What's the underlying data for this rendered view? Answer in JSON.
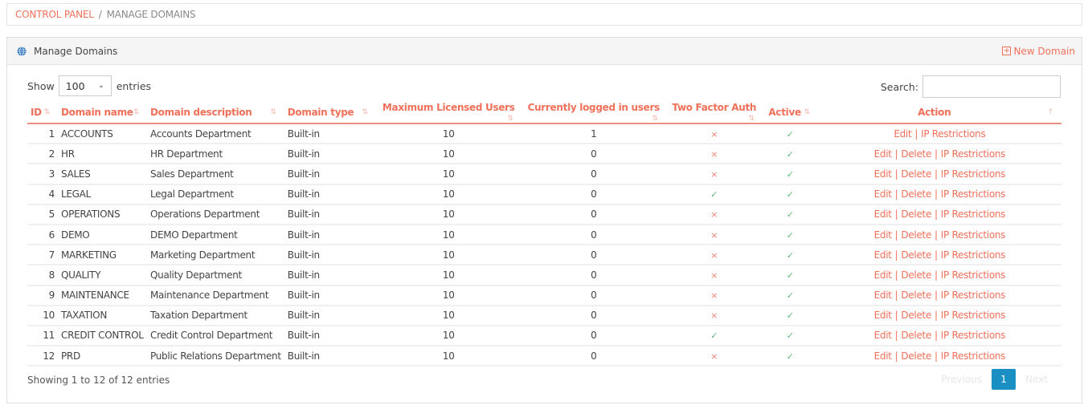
{
  "breadcrumb": {
    "home": "CONTROL PANEL",
    "separator": "/",
    "current": "MANAGE DOMAINS"
  },
  "panel": {
    "title": "Manage Domains",
    "icon": "globe-icon",
    "new_button": "New Domain"
  },
  "controls": {
    "show_label": "Show",
    "page_length": "100",
    "entries_label": "entries",
    "search_label": "Search:",
    "search_value": ""
  },
  "table": {
    "headers": [
      "ID",
      "Domain name",
      "Domain description",
      "Domain type",
      "Maximum Licensed Users",
      "Currently logged in users",
      "Two Factor Auth",
      "Active",
      "Action"
    ],
    "rows": [
      {
        "id": "1",
        "name": "ACCOUNTS",
        "desc": "Accounts Department",
        "type": "Built-in",
        "max": "10",
        "logged": "1",
        "tfa": "×",
        "active": "✓",
        "edit": "Edit",
        "delete": "",
        "ip": "IP Restrictions"
      },
      {
        "id": "2",
        "name": "HR",
        "desc": "HR Department",
        "type": "Built-in",
        "max": "10",
        "logged": "0",
        "tfa": "×",
        "active": "✓",
        "edit": "Edit",
        "delete": "Delete",
        "ip": "IP Restrictions"
      },
      {
        "id": "3",
        "name": "SALES",
        "desc": "Sales Department",
        "type": "Built-in",
        "max": "10",
        "logged": "0",
        "tfa": "×",
        "active": "✓",
        "edit": "Edit",
        "delete": "Delete",
        "ip": "IP Restrictions"
      },
      {
        "id": "4",
        "name": "LEGAL",
        "desc": "Legal Department",
        "type": "Built-in",
        "max": "10",
        "logged": "0",
        "tfa": "✓",
        "active": "✓",
        "edit": "Edit",
        "delete": "Delete",
        "ip": "IP Restrictions"
      },
      {
        "id": "5",
        "name": "OPERATIONS",
        "desc": "Operations Department",
        "type": "Built-in",
        "max": "10",
        "logged": "0",
        "tfa": "×",
        "active": "✓",
        "edit": "Edit",
        "delete": "Delete",
        "ip": "IP Restrictions"
      },
      {
        "id": "6",
        "name": "DEMO",
        "desc": "DEMO Department",
        "type": "Built-in",
        "max": "10",
        "logged": "0",
        "tfa": "×",
        "active": "✓",
        "edit": "Edit",
        "delete": "Delete",
        "ip": "IP Restrictions"
      },
      {
        "id": "7",
        "name": "MARKETING",
        "desc": "Marketing Department",
        "type": "Built-in",
        "max": "10",
        "logged": "0",
        "tfa": "×",
        "active": "✓",
        "edit": "Edit",
        "delete": "Delete",
        "ip": "IP Restrictions"
      },
      {
        "id": "8",
        "name": "QUALITY",
        "desc": "Quality Department",
        "type": "Built-in",
        "max": "10",
        "logged": "0",
        "tfa": "×",
        "active": "✓",
        "edit": "Edit",
        "delete": "Delete",
        "ip": "IP Restrictions"
      },
      {
        "id": "9",
        "name": "MAINTENANCE",
        "desc": "Maintenance Department",
        "type": "Built-in",
        "max": "10",
        "logged": "0",
        "tfa": "×",
        "active": "✓",
        "edit": "Edit",
        "delete": "Delete",
        "ip": "IP Restrictions"
      },
      {
        "id": "10",
        "name": "TAXATION",
        "desc": "Taxation Department",
        "type": "Built-in",
        "max": "10",
        "logged": "0",
        "tfa": "×",
        "active": "✓",
        "edit": "Edit",
        "delete": "Delete",
        "ip": "IP Restrictions"
      },
      {
        "id": "11",
        "name": "CREDIT CONTROL",
        "desc": "Credit Control Department",
        "type": "Built-in",
        "max": "10",
        "logged": "0",
        "tfa": "✓",
        "active": "✓",
        "edit": "Edit",
        "delete": "Delete",
        "ip": "IP Restrictions"
      },
      {
        "id": "12",
        "name": "PRD",
        "desc": "Public Relations Department",
        "type": "Built-in",
        "max": "10",
        "logged": "0",
        "tfa": "×",
        "active": "✓",
        "edit": "Edit",
        "delete": "Delete",
        "ip": "IP Restrictions"
      }
    ]
  },
  "footer": {
    "info": "Showing 1 to 12 of 12 entries",
    "previous": "Previous",
    "current_page": "1",
    "next": "Next"
  },
  "colors": {
    "accent": "#f0705a",
    "page_active": "#1a8fc4",
    "check": "#5cb87a",
    "cross": "#f08070"
  }
}
